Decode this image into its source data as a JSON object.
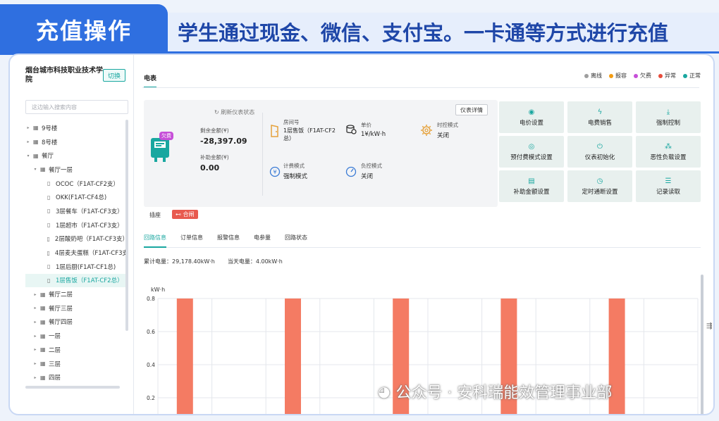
{
  "banner": {
    "tag": "充值操作",
    "text": "学生通过现金、微信、支付宝。一卡通等方式进行充值"
  },
  "sidebar": {
    "org_name": "烟台城市科技职业技术学院",
    "switch_label": "切换",
    "search_placeholder": "这边输入搜索内容",
    "tree": [
      {
        "label": "9号楼",
        "arrow": "▸",
        "icon": "building",
        "indent": 0,
        "selected": false
      },
      {
        "label": "8号楼",
        "arrow": "▸",
        "icon": "building",
        "indent": 0,
        "selected": false
      },
      {
        "label": "餐厅",
        "arrow": "▾",
        "icon": "building",
        "indent": 0,
        "selected": false
      },
      {
        "label": "餐厅一层",
        "arrow": "▾",
        "icon": "building",
        "indent": 1,
        "selected": false
      },
      {
        "label": "OCOC（F1AT-CF2支）",
        "arrow": "",
        "icon": "meter",
        "indent": 2,
        "selected": false
      },
      {
        "label": "OKK(F1AT-CF4总)",
        "arrow": "",
        "icon": "meter",
        "indent": 2,
        "selected": false
      },
      {
        "label": "3层餐车（F1AT-CF3支）",
        "arrow": "",
        "icon": "meter",
        "indent": 2,
        "selected": false
      },
      {
        "label": "1层超市（F1AT-CF3支）",
        "arrow": "",
        "icon": "meter",
        "indent": 2,
        "selected": false
      },
      {
        "label": "2层酸奶吧（F1AT-CF3支）",
        "arrow": "",
        "icon": "meter",
        "indent": 2,
        "selected": false
      },
      {
        "label": "4层麦夫蛋糕（F1AT-CF3支",
        "arrow": "",
        "icon": "meter",
        "indent": 2,
        "selected": false
      },
      {
        "label": "1层后厨(F1AT-CF1总)",
        "arrow": "",
        "icon": "meter",
        "indent": 2,
        "selected": false
      },
      {
        "label": "1层售饭（F1AT-CF2总）",
        "arrow": "",
        "icon": "meter",
        "indent": 2,
        "selected": true
      },
      {
        "label": "餐厅二层",
        "arrow": "▸",
        "icon": "building",
        "indent": 1,
        "selected": false
      },
      {
        "label": "餐厅三层",
        "arrow": "▸",
        "icon": "building",
        "indent": 1,
        "selected": false
      },
      {
        "label": "餐厅四层",
        "arrow": "▸",
        "icon": "building",
        "indent": 1,
        "selected": false
      },
      {
        "label": "一层",
        "arrow": "▸",
        "icon": "building",
        "indent": 1,
        "selected": false
      },
      {
        "label": "二层",
        "arrow": "▸",
        "icon": "building",
        "indent": 1,
        "selected": false
      },
      {
        "label": "三层",
        "arrow": "▸",
        "icon": "building",
        "indent": 1,
        "selected": false
      },
      {
        "label": "四层",
        "arrow": "▸",
        "icon": "building",
        "indent": 1,
        "selected": false
      }
    ]
  },
  "main": {
    "tab": "电表",
    "legend": [
      {
        "label": "离线",
        "color": "#9e9e9e"
      },
      {
        "label": "报容",
        "color": "#f39c12"
      },
      {
        "label": "欠费",
        "color": "#c64fd8"
      },
      {
        "label": "异常",
        "color": "#e74c3c"
      },
      {
        "label": "正常",
        "color": "#19a7a0"
      }
    ],
    "info": {
      "owe_badge": "欠费",
      "refresh": "刷新仪表状态",
      "balance_label": "剩余金额(¥)",
      "balance_value": "-28,397.09",
      "subsidy_label": "补助金额(¥)",
      "subsidy_value": "0.00",
      "room_label": "房间号",
      "room_value": "1层售饭（F1AT-CF2总）",
      "price_label": "单价",
      "price_value": "1¥/kW·h",
      "time_ctrl_label": "时控模式",
      "time_ctrl_value": "关闭",
      "billing_label": "计费模式",
      "billing_value": "强制模式",
      "load_label": "负控模式",
      "load_value": "关闭",
      "detail_button": "仪表详情"
    },
    "actions": [
      {
        "label": "电价设置",
        "icon": "price-icon",
        "glyph": "◉"
      },
      {
        "label": "电费销售",
        "icon": "lightning-icon",
        "glyph": "ϟ"
      },
      {
        "label": "强制控制",
        "icon": "download-icon",
        "glyph": "⤓"
      },
      {
        "label": "预付费模式设置",
        "icon": "prepaid-icon",
        "glyph": "◎"
      },
      {
        "label": "仪表初始化",
        "icon": "power-icon",
        "glyph": "⏻"
      },
      {
        "label": "恶性负载设置",
        "icon": "network-icon",
        "glyph": "⁂"
      },
      {
        "label": "补助金额设置",
        "icon": "subsidy-icon",
        "glyph": "▤"
      },
      {
        "label": "定时通断设置",
        "icon": "timer-icon",
        "glyph": "◷"
      },
      {
        "label": "记录读取",
        "icon": "record-icon",
        "glyph": "☰"
      }
    ],
    "plug_label": "插座",
    "close_status": "合闸",
    "sub_tabs": [
      "回路信息",
      "订单信息",
      "报警信息",
      "电参量",
      "回路状态"
    ],
    "energy": {
      "total": "累计电量：29,178.40kW·h",
      "today": "当天电量：4.00kW·h"
    }
  },
  "chart_data": {
    "type": "bar",
    "ylabel": "kW·h",
    "ylim": [
      0,
      0.8
    ],
    "yticks": [
      "0.8",
      "0.6",
      "0.4",
      "0.2"
    ],
    "categories": [
      "",
      "",
      "",
      "",
      "",
      "",
      "",
      "",
      "",
      ""
    ],
    "values": [
      0.8,
      null,
      0.8,
      null,
      0.8,
      null,
      0.8,
      null,
      0.8,
      null
    ],
    "bar_color": "#f47b63",
    "grid": true
  },
  "watermark": "公众号 · 安科瑞能效管理事业部"
}
